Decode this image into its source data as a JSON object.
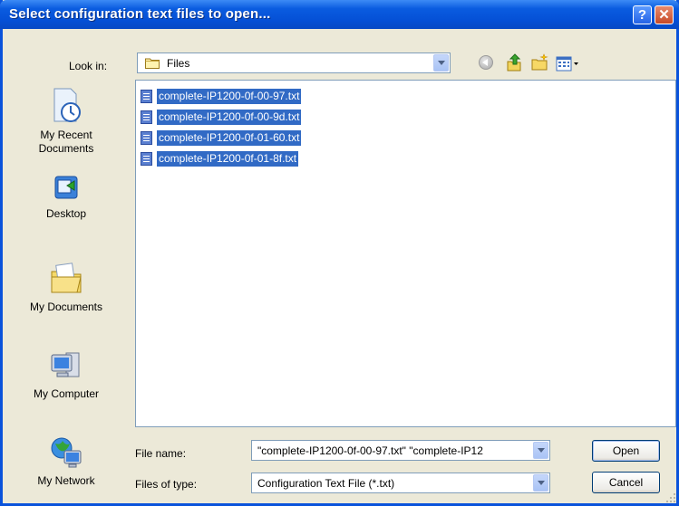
{
  "window": {
    "title": "Select configuration text files to open..."
  },
  "titlebar": {
    "help_symbol": "?",
    "close_symbol": "✕"
  },
  "lookin": {
    "label": "Look in:",
    "value": "Files"
  },
  "toolbar": {
    "icons": [
      "back-icon",
      "up-folder-icon",
      "new-folder-icon",
      "view-menu-icon"
    ]
  },
  "places": [
    {
      "label": "My Recent Documents",
      "line1": "My Recent",
      "line2": "Documents",
      "icon": "recent-documents-icon"
    },
    {
      "label": "Desktop",
      "icon": "desktop-icon"
    },
    {
      "label": "My Documents",
      "icon": "my-documents-icon"
    },
    {
      "label": "My Computer",
      "icon": "my-computer-icon"
    },
    {
      "label": "My Network",
      "icon": "my-network-icon"
    }
  ],
  "files": [
    {
      "name": "complete-IP1200-0f-00-97.txt",
      "selected": true
    },
    {
      "name": "complete-IP1200-0f-00-9d.txt",
      "selected": true
    },
    {
      "name": "complete-IP1200-0f-01-60.txt",
      "selected": true
    },
    {
      "name": "complete-IP1200-0f-01-8f.txt",
      "selected": true
    }
  ],
  "filename": {
    "label": "File name:",
    "value": "\"complete-IP1200-0f-00-97.txt\" \"complete-IP12"
  },
  "filetype": {
    "label": "Files of type:",
    "value": "Configuration Text File (*.txt)"
  },
  "buttons": {
    "open": "Open",
    "cancel": "Cancel"
  },
  "colors": {
    "titlebar": "#0A5CE0",
    "selection": "#316AC5",
    "dialog_bg": "#ECE9D8"
  }
}
